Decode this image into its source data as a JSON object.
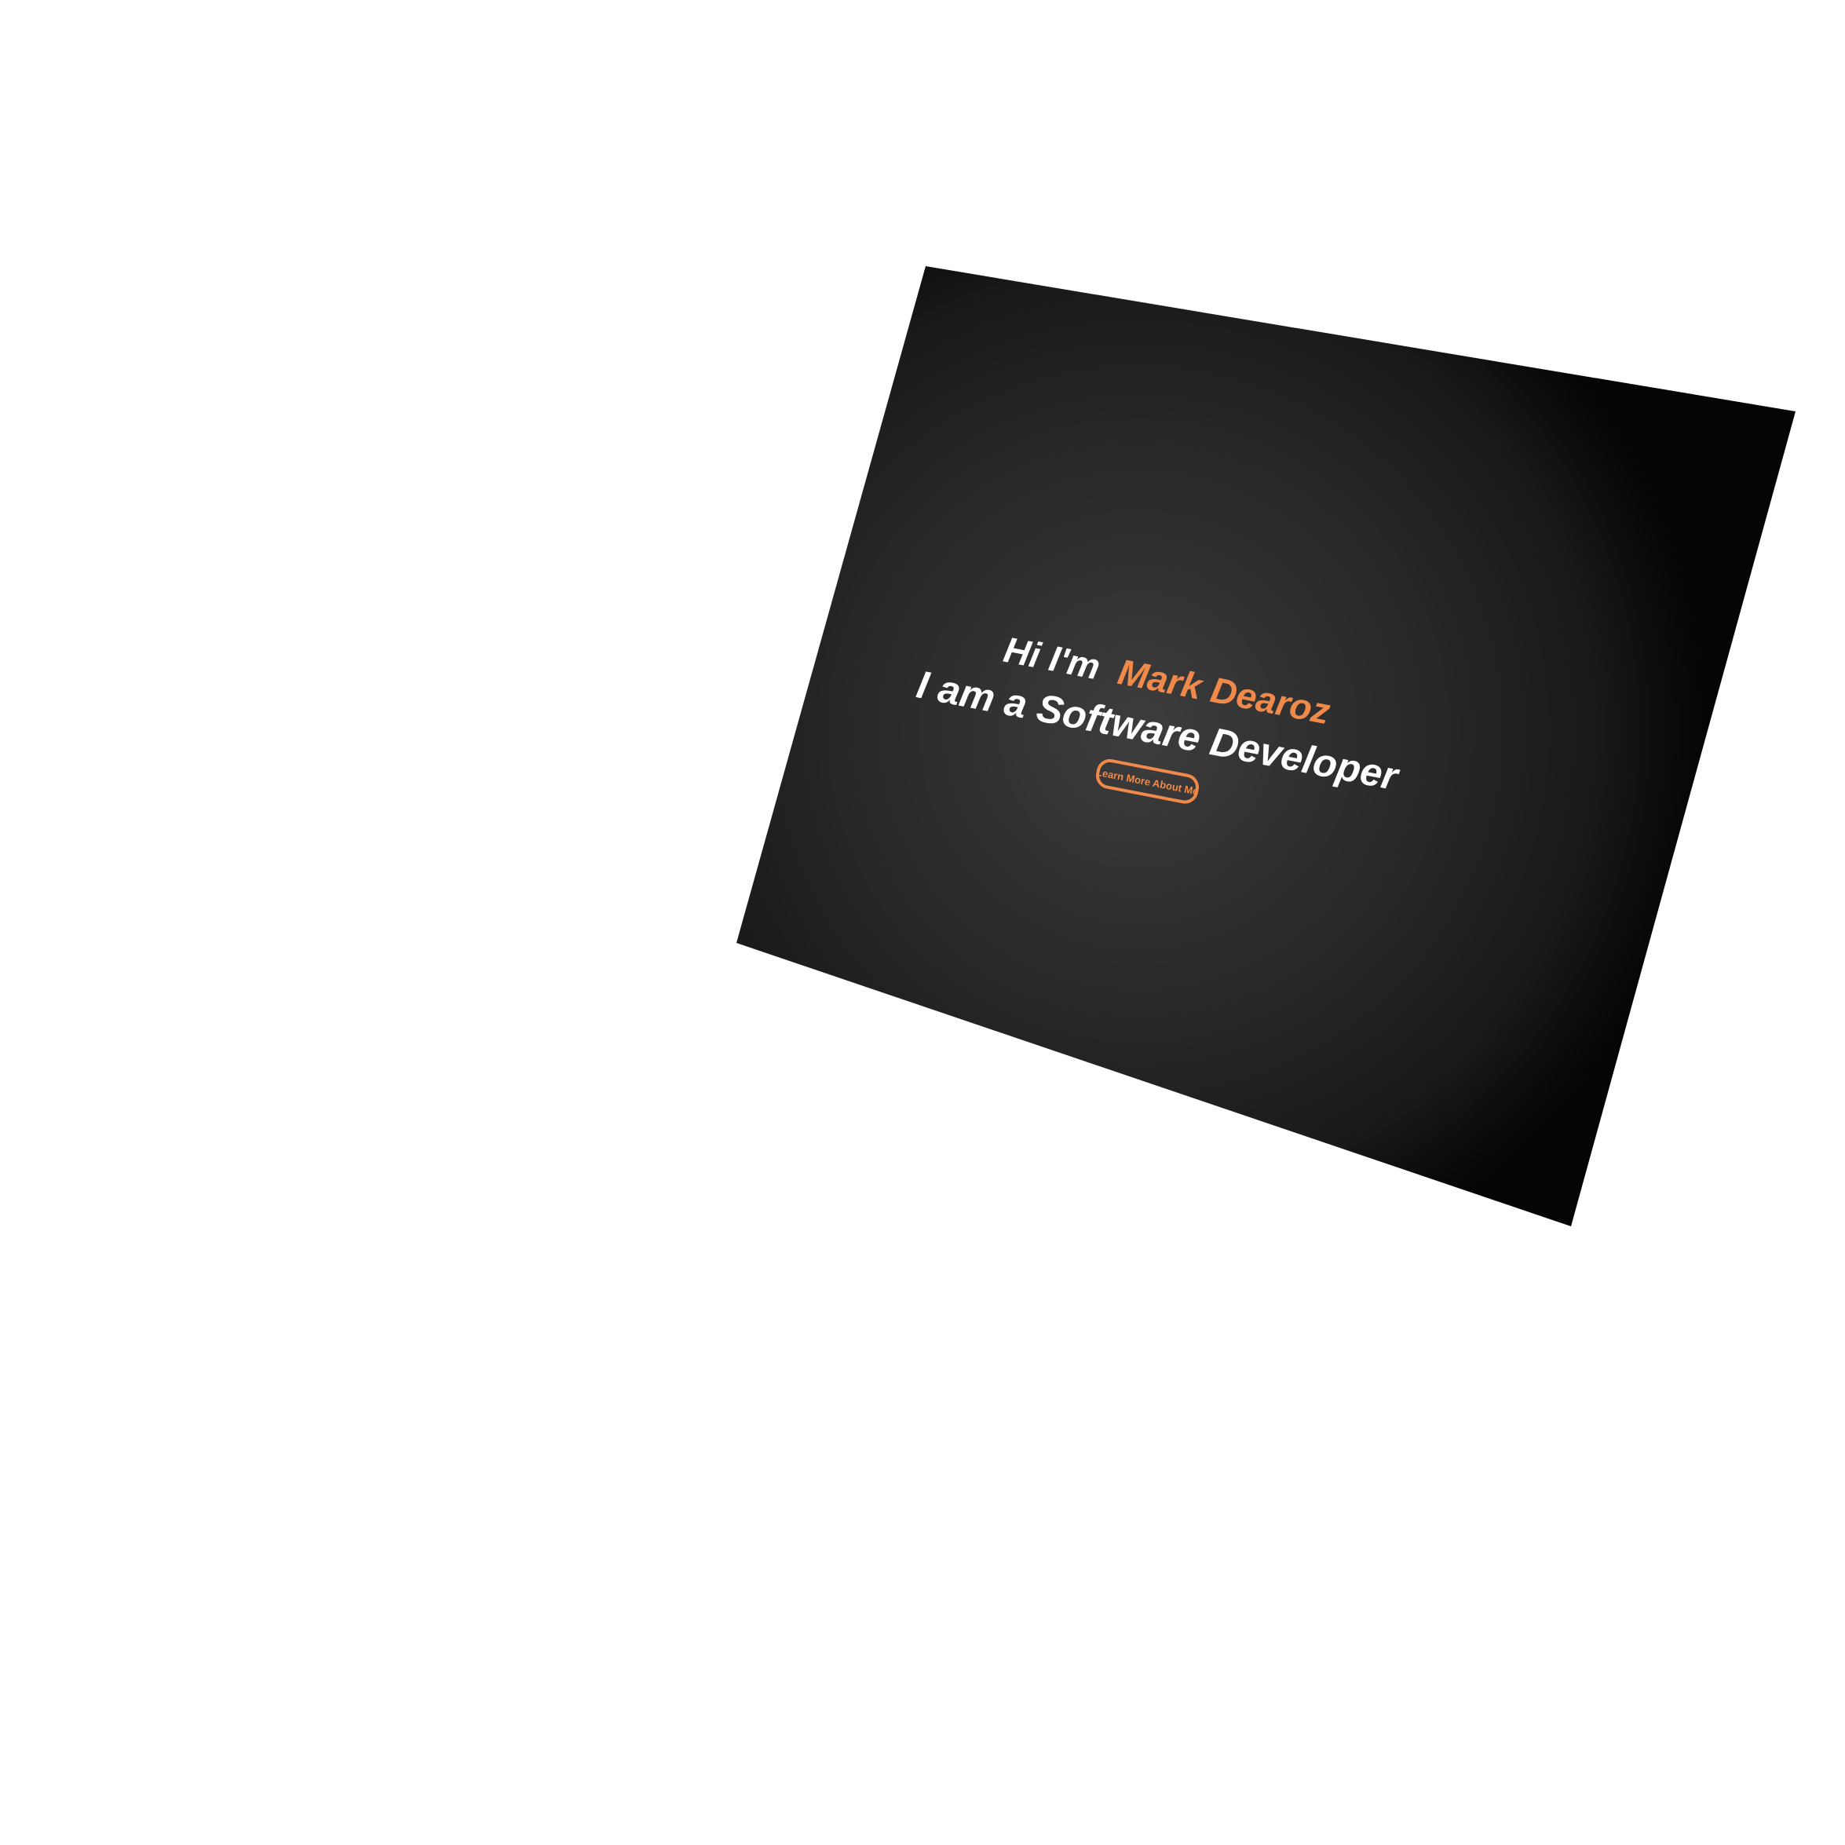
{
  "hero": {
    "greeting": "Hi I'm",
    "name": "Mark Dearoz",
    "tagline": "I am a Software Developer",
    "cta_label": "Learn More About Me"
  },
  "colors": {
    "page_background": "#ffffff",
    "panel_center": "#3a3a3a",
    "panel_edge": "#050505",
    "text_primary": "#ffffff",
    "accent": "#f08a4b"
  }
}
